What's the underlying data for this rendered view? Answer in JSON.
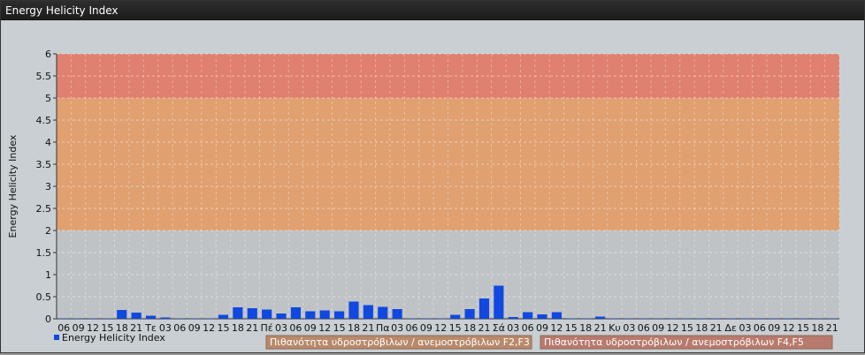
{
  "window": {
    "title": "Energy Helicity Index"
  },
  "chart_data": {
    "type": "bar",
    "ylabel": "Energy Helicity Index",
    "ylim": [
      0,
      6
    ],
    "yticks": [
      "0",
      "0.5",
      "1",
      "1.5",
      "2",
      "2.5",
      "3",
      "3.5",
      "4",
      "4.5",
      "5",
      "5.5",
      "6"
    ],
    "categories": [
      "06",
      "09",
      "12",
      "15",
      "18",
      "21",
      "Τε",
      "03",
      "06",
      "09",
      "12",
      "15",
      "18",
      "21",
      "Πέ",
      "03",
      "06",
      "09",
      "12",
      "15",
      "18",
      "21",
      "Πα",
      "03",
      "06",
      "09",
      "12",
      "15",
      "18",
      "21",
      "Σά",
      "03",
      "06",
      "09",
      "12",
      "15",
      "18",
      "21",
      "Κυ",
      "03",
      "06",
      "09",
      "12",
      "15",
      "18",
      "21",
      "Δε",
      "03",
      "06",
      "09",
      "12",
      "15",
      "18",
      "21"
    ],
    "series": [
      {
        "name": "Energy Helicity Index",
        "color": "#1048e0",
        "values": [
          0.01,
          0.01,
          0.01,
          0.01,
          0.2,
          0.14,
          0.07,
          0.03,
          0.01,
          0.01,
          0.01,
          0.09,
          0.26,
          0.24,
          0.21,
          0.12,
          0.26,
          0.17,
          0.19,
          0.17,
          0.39,
          0.31,
          0.27,
          0.22,
          0.01,
          0.01,
          0.01,
          0.09,
          0.22,
          0.46,
          0.75,
          0.04,
          0.15,
          0.1,
          0.15,
          0.01,
          0.01,
          0.05,
          0.01,
          0.01,
          0.01,
          0.01,
          0.01,
          0.01,
          0.01,
          0.01,
          0.01,
          0.01,
          0.01,
          0.01,
          0.01,
          0.01,
          0.01,
          0.01
        ]
      }
    ],
    "bands": [
      {
        "from": 2,
        "to": 5,
        "color": "#e0a070",
        "label": "Πιθανότητα υδροστρόβιλων / ανεμοστρόβιλων F2,F3"
      },
      {
        "from": 5,
        "to": 6,
        "color": "#e08070",
        "label": "Πιθανότητα υδροστρόβιλων / ανεμοστρόβιλων F4,F5"
      }
    ],
    "grid": true,
    "legend_placement": "bottom"
  }
}
